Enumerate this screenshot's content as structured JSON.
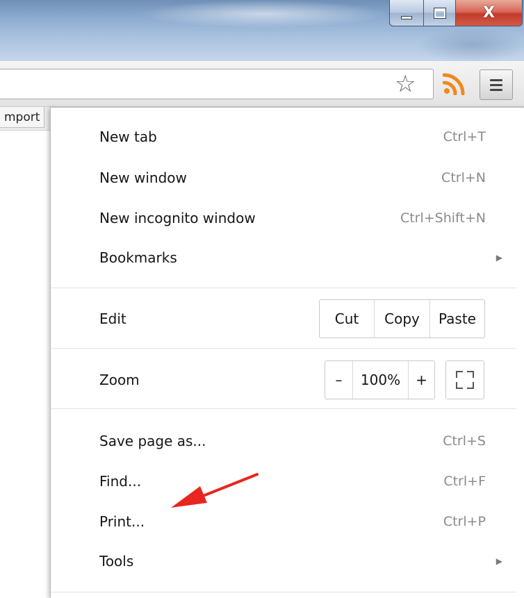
{
  "window": {
    "controls": [
      "minimize-icon",
      "maximize-icon",
      "close-icon"
    ],
    "close_glyph": "X"
  },
  "toolbar": {
    "icons": [
      "star-icon",
      "rss-icon",
      "menu-icon"
    ],
    "star_glyph": "☆"
  },
  "bookmarks_bar": {
    "item_label": "mport"
  },
  "menu": {
    "new_tab": {
      "label": "New tab",
      "shortcut": "Ctrl+T"
    },
    "new_window": {
      "label": "New window",
      "shortcut": "Ctrl+N"
    },
    "new_incognito": {
      "label": "New incognito window",
      "shortcut": "Ctrl+Shift+N"
    },
    "bookmarks": {
      "label": "Bookmarks",
      "submenu_glyph": "▶"
    },
    "edit": {
      "label": "Edit",
      "cut": "Cut",
      "copy": "Copy",
      "paste": "Paste"
    },
    "zoom": {
      "label": "Zoom",
      "minus": "–",
      "level": "100%",
      "plus": "+"
    },
    "save_page": {
      "label": "Save page as...",
      "shortcut": "Ctrl+S"
    },
    "find": {
      "label": "Find...",
      "shortcut": "Ctrl+F"
    },
    "print": {
      "label": "Print...",
      "shortcut": "Ctrl+P"
    },
    "tools": {
      "label": "Tools",
      "submenu_glyph": "▶"
    }
  },
  "colors": {
    "annotation_arrow": "#e8261f",
    "rss": "#f0881e",
    "shortcut_text": "#8a8a8a"
  }
}
